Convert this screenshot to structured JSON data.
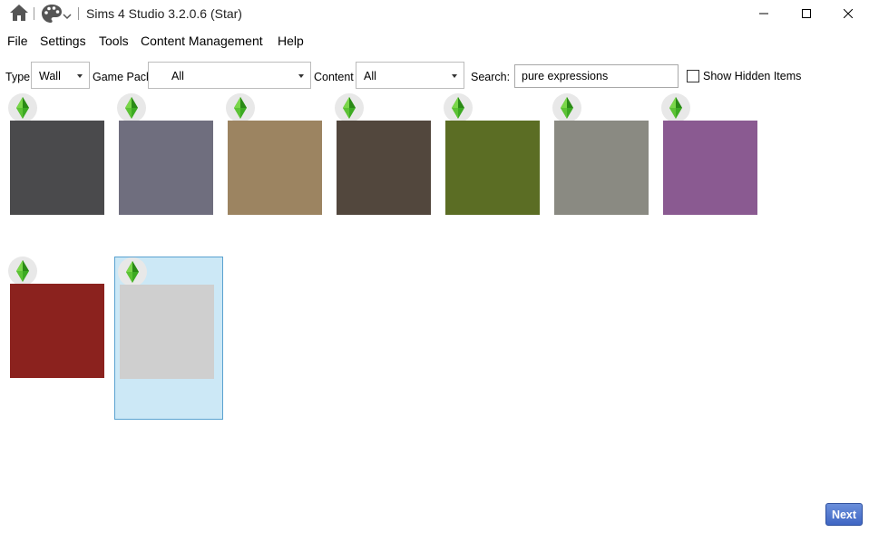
{
  "window": {
    "title": "Sims 4 Studio 3.2.0.6 (Star)",
    "icons": [
      "home-icon",
      "palette-icon",
      "chevron-down-icon"
    ],
    "controls": [
      "minimize-icon",
      "maximize-icon",
      "close-icon"
    ]
  },
  "menu": {
    "items": [
      {
        "label": "File"
      },
      {
        "label": "Settings"
      },
      {
        "label": "Tools"
      },
      {
        "label": "Content Management"
      },
      {
        "label": "Help"
      }
    ]
  },
  "filters": {
    "type_label": "Type",
    "type_value": "Wall",
    "gamepack_label": "Game Pack",
    "gamepack_value": "All",
    "content_label": "Content",
    "content_value": "All",
    "search_label": "Search:",
    "search_value": "pure expressions",
    "show_hidden_label": "Show Hidden Items",
    "show_hidden_checked": false
  },
  "grid": {
    "badge_icon": "plumbob-icon",
    "items": [
      {
        "color": "#4a4a4c",
        "selected": false
      },
      {
        "color": "#6f6e7e",
        "selected": false
      },
      {
        "color": "#9c8461",
        "selected": false
      },
      {
        "color": "#52473d",
        "selected": false
      },
      {
        "color": "#5b6d24",
        "selected": false
      },
      {
        "color": "#8a8a82",
        "selected": false
      },
      {
        "color": "#8a5a91",
        "selected": false
      },
      {
        "color": "#8b221e",
        "selected": false
      },
      {
        "color": "#cfcfcf",
        "selected": true
      }
    ]
  },
  "footer": {
    "next_label": "Next"
  }
}
